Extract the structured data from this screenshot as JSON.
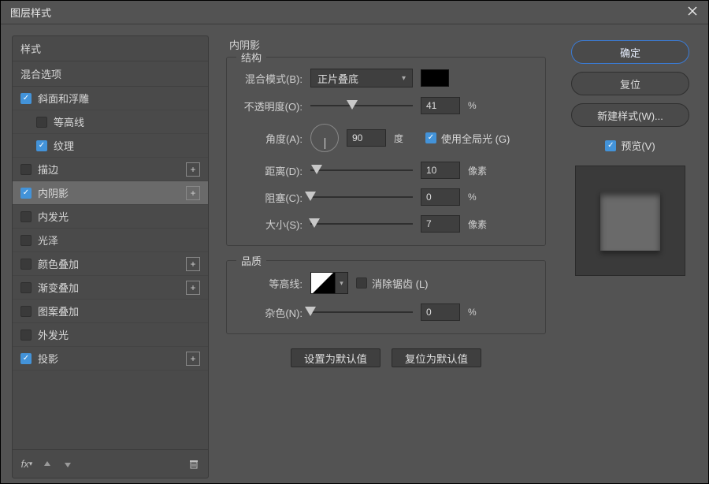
{
  "dialog": {
    "title": "图层样式"
  },
  "left": {
    "header1": "样式",
    "header2": "混合选项",
    "items": [
      {
        "label": "斜面和浮雕",
        "checked": true,
        "plus": false,
        "indent": false
      },
      {
        "label": "等高线",
        "checked": false,
        "plus": false,
        "indent": true
      },
      {
        "label": "纹理",
        "checked": true,
        "plus": false,
        "indent": true
      },
      {
        "label": "描边",
        "checked": false,
        "plus": true,
        "indent": false
      },
      {
        "label": "内阴影",
        "checked": true,
        "plus": true,
        "indent": false,
        "selected": true
      },
      {
        "label": "内发光",
        "checked": false,
        "plus": false,
        "indent": false
      },
      {
        "label": "光泽",
        "checked": false,
        "plus": false,
        "indent": false
      },
      {
        "label": "颜色叠加",
        "checked": false,
        "plus": true,
        "indent": false
      },
      {
        "label": "渐变叠加",
        "checked": false,
        "plus": true,
        "indent": false
      },
      {
        "label": "图案叠加",
        "checked": false,
        "plus": false,
        "indent": false
      },
      {
        "label": "外发光",
        "checked": false,
        "plus": false,
        "indent": false
      },
      {
        "label": "投影",
        "checked": true,
        "plus": true,
        "indent": false
      }
    ],
    "fx_label": "fx"
  },
  "center": {
    "title": "内阴影",
    "structure": {
      "legend": "结构",
      "blend_label": "混合模式(B):",
      "blend_value": "正片叠底",
      "opacity_label": "不透明度(O):",
      "opacity_value": "41",
      "opacity_unit": "%",
      "angle_label": "角度(A):",
      "angle_value": "90",
      "angle_unit": "度",
      "global_light_label": "使用全局光 (G)",
      "global_light_checked": true,
      "distance_label": "距离(D):",
      "distance_value": "10",
      "distance_unit": "像素",
      "choke_label": "阻塞(C):",
      "choke_value": "0",
      "choke_unit": "%",
      "size_label": "大小(S):",
      "size_value": "7",
      "size_unit": "像素"
    },
    "quality": {
      "legend": "品质",
      "contour_label": "等高线:",
      "antialias_label": "消除锯齿 (L)",
      "antialias_checked": false,
      "noise_label": "杂色(N):",
      "noise_value": "0",
      "noise_unit": "%"
    },
    "set_default": "设置为默认值",
    "reset_default": "复位为默认值"
  },
  "right": {
    "ok": "确定",
    "cancel": "复位",
    "new_style": "新建样式(W)...",
    "preview_label": "预览(V)",
    "preview_checked": true
  }
}
